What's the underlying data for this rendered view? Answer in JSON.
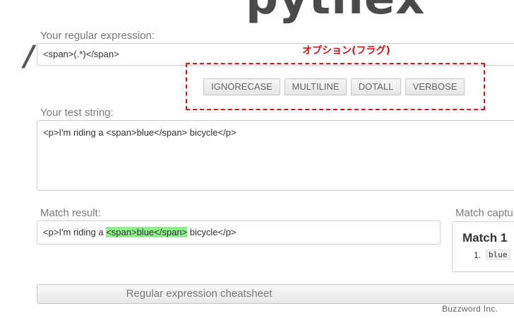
{
  "app": {
    "logo": "pythex"
  },
  "regex": {
    "label": "Your regular expression:",
    "slash": "/",
    "value": "<span>(.*)</span>"
  },
  "annotation": {
    "text": "オプション(フラグ)",
    "color": "#d4161c"
  },
  "flags": [
    {
      "label": "IGNORECASE",
      "active": false
    },
    {
      "label": "MULTILINE",
      "active": false
    },
    {
      "label": "DOTALL",
      "active": false
    },
    {
      "label": "VERBOSE",
      "active": false
    }
  ],
  "test_string": {
    "label": "Your test string:",
    "value": "<p>I'm riding a <span>blue</span> bicycle</p>"
  },
  "match_result": {
    "label": "Match result:",
    "before": "<p>I'm riding a ",
    "match": "<span>blue</span>",
    "after": " bicycle</p>",
    "highlight_color": "#8ff08a"
  },
  "captures": {
    "label": "Match captu",
    "title": "Match 1",
    "items": [
      {
        "num": "1.",
        "value": "blue"
      }
    ]
  },
  "cheatsheet_button": "Regular expression cheatsheet",
  "credit": "Buzzword Inc."
}
